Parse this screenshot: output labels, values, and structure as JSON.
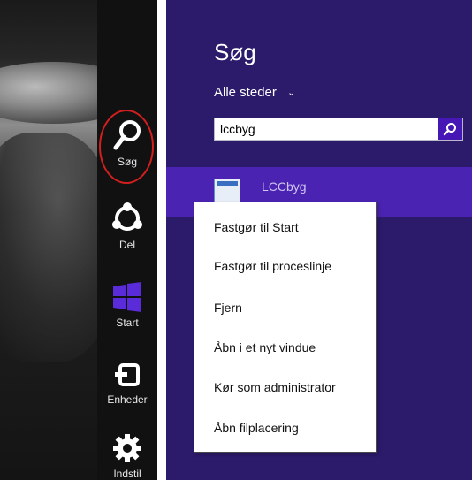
{
  "charms_bar": {
    "items": [
      {
        "label": "Søg",
        "icon": "search-icon"
      },
      {
        "label": "Del",
        "icon": "share-icon"
      },
      {
        "label": "Start",
        "icon": "windows-logo-icon"
      },
      {
        "label": "Enheder",
        "icon": "devices-icon"
      },
      {
        "label": "Indstil",
        "icon": "gear-icon"
      }
    ],
    "highlight_color": "#d11f1f"
  },
  "search_pane": {
    "title": "Søg",
    "scope_label": "Alle steder",
    "search": {
      "value": "lccbyg",
      "placeholder": ""
    },
    "result": {
      "label": "LCCbyg",
      "icon": "app-window-icon"
    },
    "accent_color": "#2c1a6b",
    "highlight_color": "#4a23b2"
  },
  "context_menu": {
    "items": [
      "Fastgør til Start",
      "Fastgør til proceslinje",
      "Fjern",
      "Åbn i et nyt vindue",
      "Kør som administrator",
      "Åbn filplacering"
    ]
  }
}
